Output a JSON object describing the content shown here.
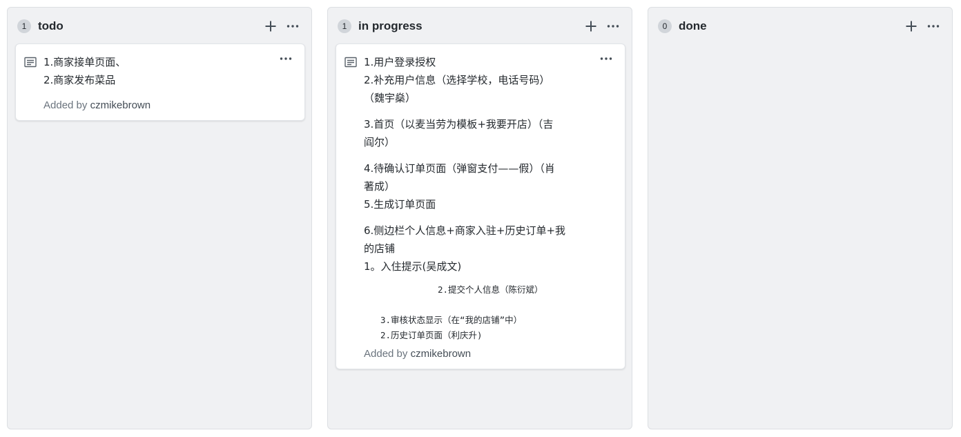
{
  "columns": [
    {
      "count": "1",
      "title": "todo",
      "cards": [
        {
          "lines": [
            "1.商家接单页面、",
            "2.商家发布菜品"
          ],
          "added_by_prefix": "Added by",
          "added_by_user": "czmikebrown"
        }
      ]
    },
    {
      "count": "1",
      "title": "in progress",
      "cards": [
        {
          "lines": [
            "1.用户登录授权",
            "2.补充用户信息（选择学校，电话号码）",
            "（魏宇燊）",
            "3.首页（以麦当劳为模板+我要开店）（吉",
            "阎尔）",
            "4.待确认订单页面（弹窗支付——假）（肖",
            "著成）",
            "5.生成订单页面",
            "6.侧边栏个人信息+商家入驻+历史订单+我",
            "的店铺",
            "1。入住提示(吴成文)",
            "2.提交个人信息（陈衍斌）",
            "3.审核状态显示（在“我的店铺”中）",
            "2.历史订单页面（利庆升)"
          ],
          "added_by_prefix": "Added by",
          "added_by_user": "czmikebrown"
        }
      ]
    },
    {
      "count": "0",
      "title": "done",
      "cards": []
    }
  ],
  "icons": {
    "add": "plus-icon",
    "menu": "kebab-horizontal-icon",
    "note": "note-icon"
  }
}
